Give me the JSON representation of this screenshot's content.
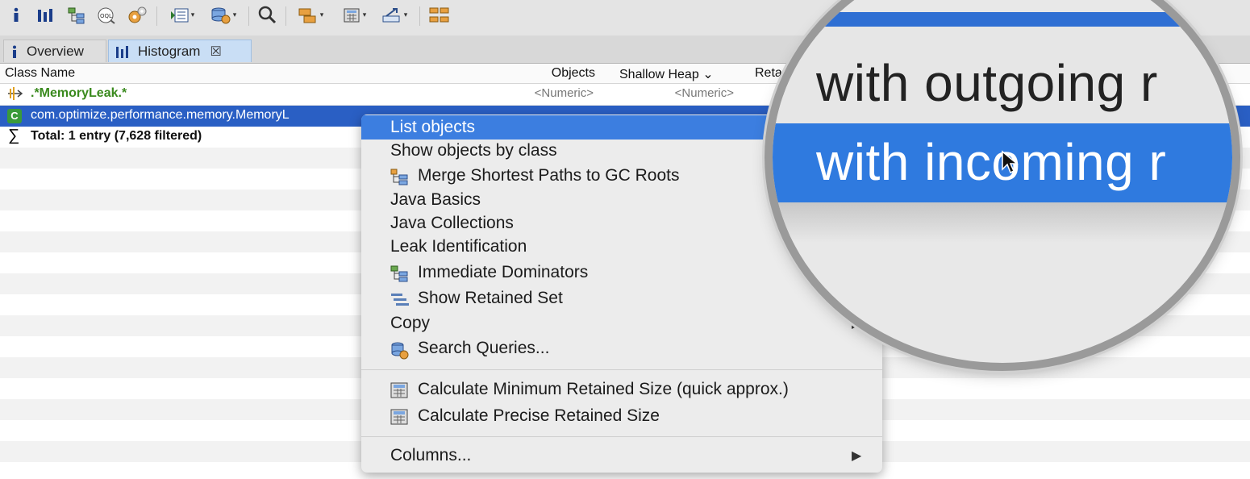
{
  "tabs": [
    {
      "label": "Overview"
    },
    {
      "label": "Histogram",
      "close": "☒"
    }
  ],
  "table": {
    "columns": [
      "Class Name",
      "Objects",
      "Shallow Heap",
      "Reta"
    ],
    "sort_indicator": "⌄",
    "filter_row": {
      "pattern": ".*MemoryLeak.*",
      "objects": "<Numeric>",
      "shallow": "<Numeric>"
    },
    "data_row": {
      "class_badge": "C",
      "class_name": "com.optimize.performance.memory.MemoryL"
    },
    "total_row": {
      "sigma": "∑",
      "text": "Total: 1 entry (7,628 filtered)"
    }
  },
  "context_menu": {
    "items": [
      {
        "label": "List objects",
        "selected": true
      },
      {
        "label": "Show objects by class"
      },
      {
        "label": "Merge Shortest Paths to GC Roots",
        "icon": "merge-paths-icon"
      },
      {
        "label": "Java Basics"
      },
      {
        "label": "Java Collections"
      },
      {
        "label": "Leak Identification"
      },
      {
        "label": "Immediate Dominators",
        "icon": "dominators-icon"
      },
      {
        "label": "Show Retained Set",
        "icon": "retained-set-icon"
      },
      {
        "label": "Copy",
        "submenu": "▶"
      },
      {
        "label": "Search Queries...",
        "icon": "search-queries-icon"
      },
      {
        "label": "Calculate Minimum Retained Size (quick approx.)",
        "icon": "calculator-icon"
      },
      {
        "label": "Calculate Precise Retained Size",
        "icon": "calculator-icon"
      },
      {
        "label": "Columns...",
        "submenu": "▶"
      }
    ]
  },
  "magnifier": {
    "line1": "with outgoing r",
    "line2": "with incoming r"
  },
  "colors": {
    "selection": "#3c7ee0",
    "row_selected": "#2a5fc4",
    "tab_active": "#c9def5",
    "filter_text": "#3a8a1e"
  }
}
